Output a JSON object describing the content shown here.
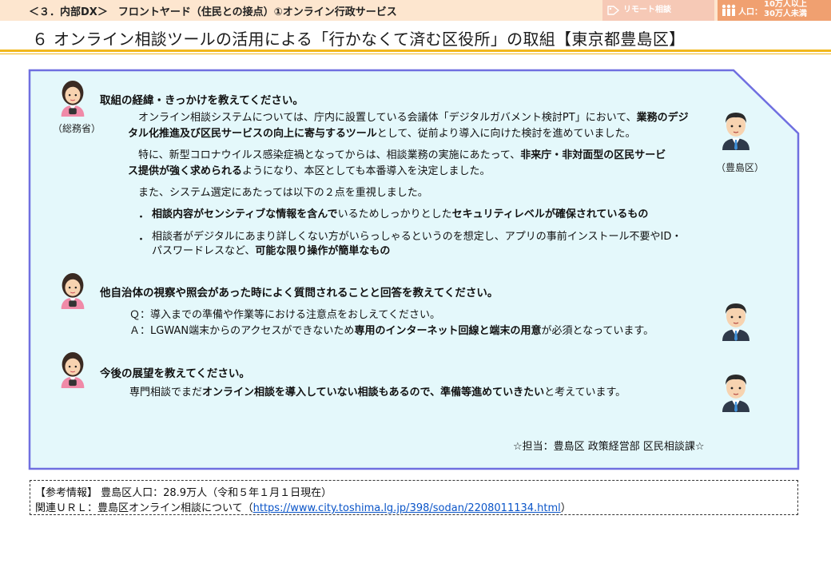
{
  "header": {
    "breadcrumb": "＜３．内部DX＞　フロントヤード（住民との接点）①オンライン行政サービス",
    "tag_remote": "リモート相談",
    "tag_pop_label": "人口：",
    "tag_pop_line1": "10万人以上",
    "tag_pop_line2": "30万人未満",
    "title": "６  オンライン相談ツールの活用による「行かなくて済む区役所」の取組【東京都豊島区】"
  },
  "speakers": {
    "ministry_caption": "（総務省）",
    "ward_caption": "（豊島区）"
  },
  "q1": {
    "question": "取組の経緯・きっかけを教えてください。",
    "a1_l1_pre": "　オンライン相談システムについては、庁内に設置している会議体「デジタルガバメント検討PT」において、",
    "a1_l1_bold": "業務のデジ",
    "a1_l2_bold": "タル化推進及び区民サービスの向上に寄与するツール",
    "a1_l2_post": "として、従前より導入に向けた検討を進めていました。",
    "a2_l1_pre": "　特に、新型コロナウイルス感染症禍となってからは、相談業務の実施にあたって、",
    "a2_l1_bold": "非来庁・非対面型の区民サービ",
    "a2_l2_bold": "ス提供が強く求められる",
    "a2_l2_post": "ようになり、本区としても本番導入を決定しました。",
    "a3": "　また、システム選定にあたっては以下の２点を重視しました。",
    "b1_bold1": "相談内容がセンシティブな情報を含んで",
    "b1_mid": "いるためしっかりとした",
    "b1_bold2": "セキュリティレベルが確保されているもの",
    "b2_l1": "相談者がデジタルにあまり詳しくない方がいらっしゃるというのを想定し、アプリの事前インストール不要やID・",
    "b2_l2_pre": "パスワードレスなど、",
    "b2_l2_bold": "可能な限り操作が簡単なもの",
    "bullet_mark": "・"
  },
  "q2": {
    "question": "他自治体の視察や照会があった時によく質問されることと回答を教えてください。",
    "q_line": "Ｑ：導入までの準備や作業等における注意点をおしえてください。",
    "a_pre": "Ａ：LGWAN端末からのアクセスができないため",
    "a_bold": "専用のインターネット回線と端末の用意",
    "a_post": "が必須となっています。"
  },
  "q3": {
    "question": "今後の展望を教えてください。",
    "a_pre": "専門相談でまだ",
    "a_bold": "オンライン相談を導入していない相談もあるので、準備等進めていきたい",
    "a_post": "と考えています。"
  },
  "contact": "☆担当：豊島区 政策経営部 区民相談課☆",
  "reference": {
    "line1": "【参考情報】  豊島区人口：28.9万人（令和５年１月１日現在）",
    "line2_pre": "関連ＵＲＬ：豊島区オンライン相談について（",
    "url": "https://www.city.toshima.lg.jp/398/sodan/2208011134.html",
    "line2_post": "）"
  },
  "colors": {
    "panel_fill": "#e4f8fb",
    "panel_border": "#6f6fe0",
    "accent_rule": "#f1b71c",
    "top_bar": "#fde6cf"
  }
}
